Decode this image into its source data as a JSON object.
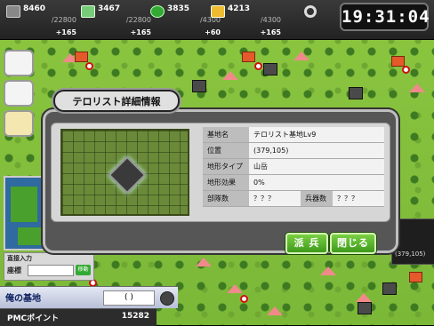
{
  "status_bar": {
    "resources": [
      {
        "icon": "oil-icon",
        "value": "8460",
        "max": "/22800",
        "income": "+165"
      },
      {
        "icon": "supply-icon",
        "value": "3467",
        "max": "/22800",
        "income": "+165"
      },
      {
        "icon": "soldier-icon",
        "value": "3835",
        "max": "/4300",
        "income": "+60"
      },
      {
        "icon": "gold-icon",
        "value": "4213",
        "max": "/4300",
        "income": "+165"
      }
    ],
    "extra_icon": "ring-icon",
    "clock": "19:31:04"
  },
  "dialog": {
    "title": "テロリスト詳細情報",
    "info": {
      "base_name_label": "基地名",
      "base_name_value": "テロリスト基地Lv9",
      "position_label": "位置",
      "position_value": "(379,105)",
      "terrain_label": "地形タイプ",
      "terrain_value": "山岳",
      "effect_label": "地形効果",
      "effect_value": "0%",
      "squads_label": "部隊数",
      "squads_value": "？？？",
      "weapons_label": "兵器数",
      "weapons_value": "？？？"
    },
    "buttons": {
      "dispatch": "派 兵",
      "close": "閉じる"
    }
  },
  "sidebar": {
    "coord_input_title": "直接入力",
    "coord_label": "座標",
    "coord_go": "移動"
  },
  "base_bar": {
    "label": "俺の基地",
    "box": "(          )"
  },
  "pmc": {
    "label": "PMCポイント",
    "value": "15282"
  },
  "peek": {
    "coord": "(379,105)"
  }
}
